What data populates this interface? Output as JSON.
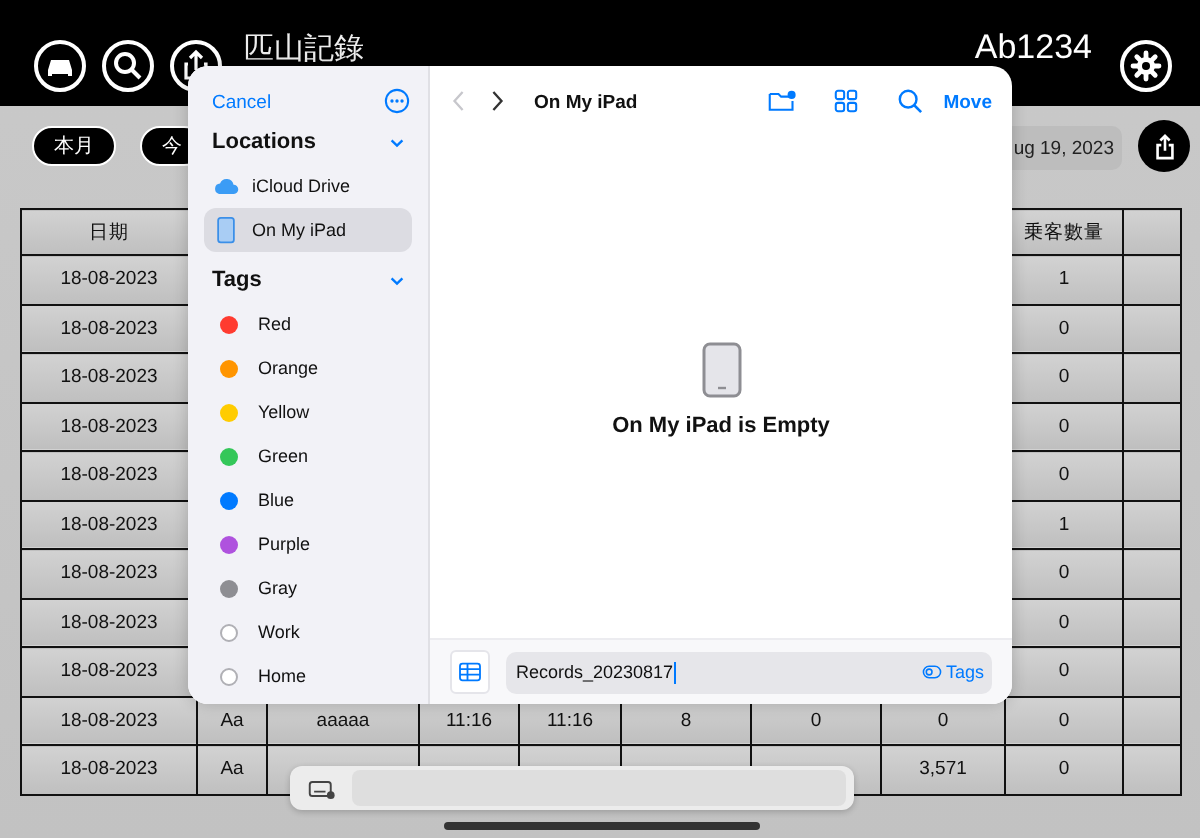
{
  "top_bar": {
    "title": "匹山記錄",
    "vehicle_id": "Ab1234"
  },
  "filters": {
    "period_buttons": [
      "本月",
      "今"
    ],
    "date": "ug 19, 2023"
  },
  "table": {
    "columns": [
      "日期",
      null,
      null,
      null,
      null,
      null,
      null,
      null,
      "乗客數量",
      null
    ],
    "rows": [
      {
        "cells": [
          "18-08-2023",
          null,
          null,
          null,
          null,
          null,
          null,
          null,
          "1",
          null
        ]
      },
      {
        "cells": [
          "18-08-2023",
          null,
          null,
          null,
          null,
          null,
          null,
          null,
          "0",
          null
        ]
      },
      {
        "cells": [
          "18-08-2023",
          null,
          null,
          null,
          null,
          null,
          null,
          null,
          "0",
          null
        ]
      },
      {
        "cells": [
          "18-08-2023",
          null,
          null,
          null,
          null,
          null,
          null,
          null,
          "0",
          null
        ]
      },
      {
        "cells": [
          "18-08-2023",
          null,
          null,
          null,
          null,
          null,
          null,
          null,
          "0",
          null
        ]
      },
      {
        "cells": [
          "18-08-2023",
          null,
          null,
          null,
          null,
          null,
          null,
          null,
          "1",
          null
        ]
      },
      {
        "cells": [
          "18-08-2023",
          null,
          null,
          null,
          null,
          null,
          null,
          null,
          "0",
          null
        ]
      },
      {
        "cells": [
          "18-08-2023",
          null,
          null,
          null,
          null,
          null,
          null,
          null,
          "0",
          null
        ]
      },
      {
        "cells": [
          "18-08-2023",
          null,
          null,
          null,
          null,
          null,
          null,
          null,
          "0",
          null
        ]
      },
      {
        "cells": [
          "18-08-2023",
          "Aa",
          "aaaaa",
          "11:16",
          "11:16",
          "8",
          "0",
          "0",
          "0",
          null
        ]
      },
      {
        "cells": [
          "18-08-2023",
          "Aa",
          null,
          null,
          null,
          null,
          null,
          "3,571",
          "0",
          null
        ]
      }
    ]
  },
  "file_picker": {
    "cancel": "Cancel",
    "sections": [
      {
        "title": "Locations",
        "expanded": true,
        "items": [
          {
            "label": "iCloud Drive",
            "kind": "cloud",
            "selected": false
          },
          {
            "label": "On My iPad",
            "kind": "device",
            "selected": true
          }
        ]
      },
      {
        "title": "Tags",
        "expanded": true,
        "items": [
          {
            "label": "Red",
            "kind": "tag",
            "color": "#ff3b30"
          },
          {
            "label": "Orange",
            "kind": "tag",
            "color": "#ff9500"
          },
          {
            "label": "Yellow",
            "kind": "tag",
            "color": "#ffcc00"
          },
          {
            "label": "Green",
            "kind": "tag",
            "color": "#34c759"
          },
          {
            "label": "Blue",
            "kind": "tag",
            "color": "#007aff"
          },
          {
            "label": "Purple",
            "kind": "tag",
            "color": "#af52de"
          },
          {
            "label": "Gray",
            "kind": "tag",
            "color": "#8e8e93"
          },
          {
            "label": "Work",
            "kind": "tag"
          },
          {
            "label": "Home",
            "kind": "tag"
          }
        ]
      }
    ],
    "back_enabled": false,
    "forward_enabled": true,
    "title": "On My iPad",
    "action": "Move",
    "empty_message": "On My iPad is Empty",
    "filename": "Records_20230817",
    "tags_button": "Tags"
  }
}
